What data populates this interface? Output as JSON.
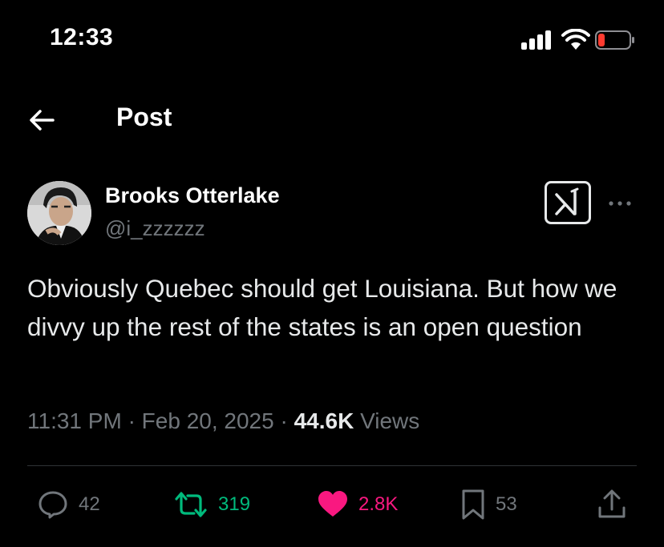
{
  "status_bar": {
    "time": "12:33"
  },
  "header": {
    "title": "Post",
    "back_icon": "arrow-left-icon"
  },
  "author": {
    "name": "Brooks Otterlake",
    "handle": "@i_zzzzzz"
  },
  "post": {
    "text": "Obviously Quebec should get Louisiana. But how we divvy up the rest of the states is an open question",
    "time": "11:31 PM",
    "separator": "·",
    "date": "Feb 20, 2025",
    "views_count": "44.6K",
    "views_label": "Views"
  },
  "actions": {
    "replies": "42",
    "reposts": "319",
    "likes": "2.8K",
    "bookmarks": "53"
  },
  "colors": {
    "background": "#000000",
    "text": "#e7e9ea",
    "muted": "#71767b",
    "repost_green": "#00ba7c",
    "like_pink": "#f91880",
    "battery_red": "#ff3b30"
  }
}
